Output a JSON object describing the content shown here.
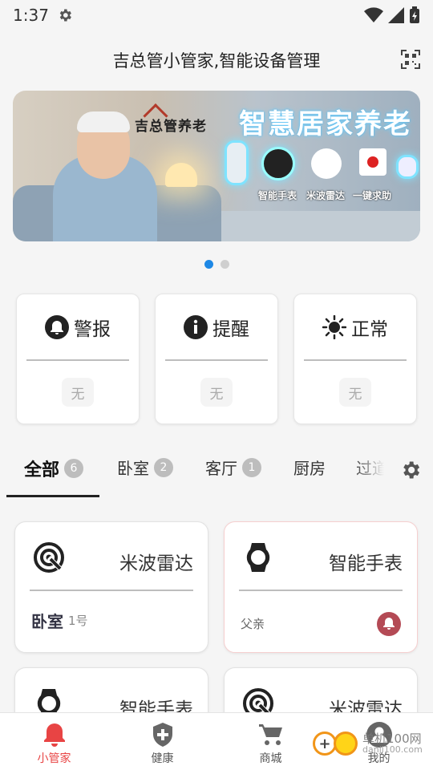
{
  "status_bar": {
    "time": "1:37"
  },
  "header": {
    "title": "吉总管小管家,智能设备管理"
  },
  "banner": {
    "brand": "吉总管养老",
    "slogan": "智慧居家养老",
    "labels": [
      "智能手表",
      "米波雷达",
      "一键求助"
    ]
  },
  "carousel": {
    "count": 2,
    "active": 0
  },
  "status_cards": [
    {
      "label": "警报",
      "icon": "bell-icon",
      "value": "无"
    },
    {
      "label": "提醒",
      "icon": "info-icon",
      "value": "无"
    },
    {
      "label": "正常",
      "icon": "sun-icon",
      "value": "无"
    }
  ],
  "tabs": [
    {
      "label": "全部",
      "count": "6"
    },
    {
      "label": "卧室",
      "count": "2"
    },
    {
      "label": "客厅",
      "count": "1"
    },
    {
      "label": "厨房",
      "count": ""
    },
    {
      "label": "过道",
      "count": ""
    }
  ],
  "devices": [
    {
      "name": "米波雷达",
      "icon": "radar-icon",
      "room": "卧室",
      "sub": "1号"
    },
    {
      "name": "智能手表",
      "icon": "watch-icon",
      "owner": "父亲"
    },
    {
      "name": "智能手表",
      "icon": "watch-icon"
    },
    {
      "name": "米波雷达",
      "icon": "radar-icon"
    }
  ],
  "bottom_nav": [
    {
      "label": "小管家",
      "icon": "bell-icon"
    },
    {
      "label": "健康",
      "icon": "shield-plus-icon"
    },
    {
      "label": "商城",
      "icon": "cart-icon"
    },
    {
      "label": "我的",
      "icon": "user-icon"
    }
  ],
  "watermark": {
    "title": "单机100网",
    "url": "danji100.com"
  },
  "colors": {
    "accent": "#e84444",
    "dot_active": "#1e88e5",
    "alert_bell": "#b44a55"
  }
}
